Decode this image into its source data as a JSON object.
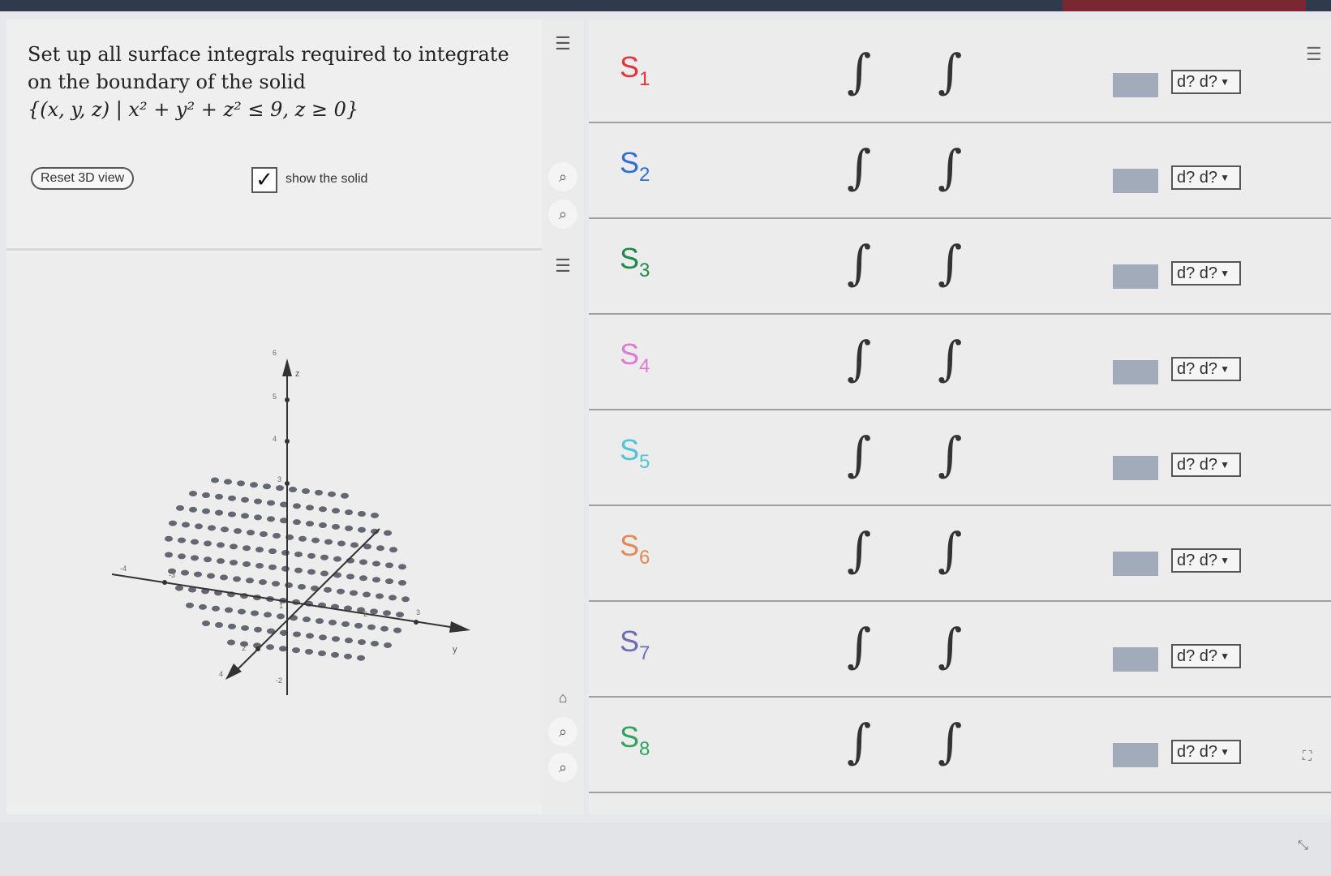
{
  "question": {
    "line1": "Set up all surface integrals required to integrate",
    "line2": "on the boundary of the solid",
    "set": "{(x, y, z) | x² + y² + z² ≤ 9,  z ≥ 0}"
  },
  "controls": {
    "reset_label": "Reset 3D view",
    "show_solid_label": "show the solid",
    "show_solid_checked": true
  },
  "tools": {
    "menu_icon": "menu-settings-icon",
    "zoom_in_icon": "zoom-in-icon",
    "zoom_out_icon": "zoom-out-icon",
    "graph_menu_icon": "graph-menu-icon",
    "home_icon": "home-icon"
  },
  "graph_labels": {
    "z_axis": "z",
    "y_axis": "y",
    "z_ticks": [
      "6",
      "5",
      "4",
      "3",
      "-2"
    ],
    "x_ticks": [
      "4",
      "2",
      "-1",
      "1",
      "2",
      "3"
    ],
    "y_ticks": [
      "-4",
      "-3",
      "2",
      "3"
    ]
  },
  "surfaces": [
    {
      "name": "S",
      "sub": "1",
      "color": "#e0353a",
      "integral": "∫",
      "diff_label": "d? d?"
    },
    {
      "name": "S",
      "sub": "2",
      "color": "#2e6fd0",
      "integral": "∫",
      "diff_label": "d? d?"
    },
    {
      "name": "S",
      "sub": "3",
      "color": "#1f8a4a",
      "integral": "∫",
      "diff_label": "d? d?"
    },
    {
      "name": "S",
      "sub": "4",
      "color": "#e07ad0",
      "integral": "∫",
      "diff_label": "d? d?"
    },
    {
      "name": "S",
      "sub": "5",
      "color": "#4fc4d8",
      "integral": "∫",
      "diff_label": "d? d?"
    },
    {
      "name": "S",
      "sub": "6",
      "color": "#e08a55",
      "integral": "∫",
      "diff_label": "d? d?"
    },
    {
      "name": "S",
      "sub": "7",
      "color": "#6a6fb4",
      "integral": "∫",
      "diff_label": "d? d?"
    },
    {
      "name": "S",
      "sub": "8",
      "color": "#2ea55a",
      "integral": "∫",
      "diff_label": "d? d?"
    }
  ]
}
